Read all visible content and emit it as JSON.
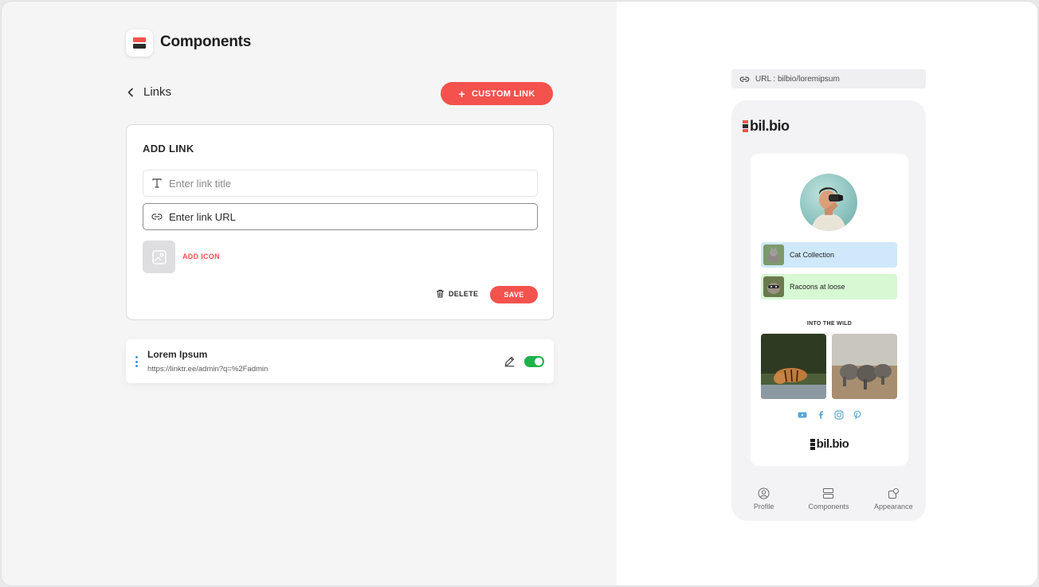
{
  "app": {
    "title": "Components"
  },
  "header": {
    "back_label": "Links",
    "custom_link_label": "CUSTOM LINK"
  },
  "add_link": {
    "title": "ADD LINK",
    "title_placeholder": "Enter link title",
    "url_placeholder": "Enter link URL",
    "add_icon_label": "ADD ICON",
    "delete_label": "DELETE",
    "save_label": "SAVE"
  },
  "links": [
    {
      "title": "Lorem Ipsum",
      "url": "https://linktr.ee/admin?q=%2Fadmin",
      "enabled": true
    }
  ],
  "preview": {
    "url_text": "URL : bilbio/loremipsum",
    "brand": "bil.bio",
    "profile_links": [
      {
        "label": "Cat Collection",
        "color": "#cfe9fb"
      },
      {
        "label": "Racoons at loose",
        "color": "#d6f8d2"
      }
    ],
    "section_title": "INTO THE WILD",
    "socials": [
      "youtube-icon",
      "facebook-icon",
      "instagram-icon",
      "pinterest-icon"
    ],
    "footer_brand": "bil.bio",
    "tabs": [
      {
        "label": "Profile",
        "icon": "user-circle-icon"
      },
      {
        "label": "Components",
        "icon": "components-icon"
      },
      {
        "label": "Appearance",
        "icon": "appearance-icon"
      }
    ]
  },
  "colors": {
    "accent": "#f4524d",
    "toggle_on": "#1fb24a",
    "social": "#5aa7d6"
  }
}
